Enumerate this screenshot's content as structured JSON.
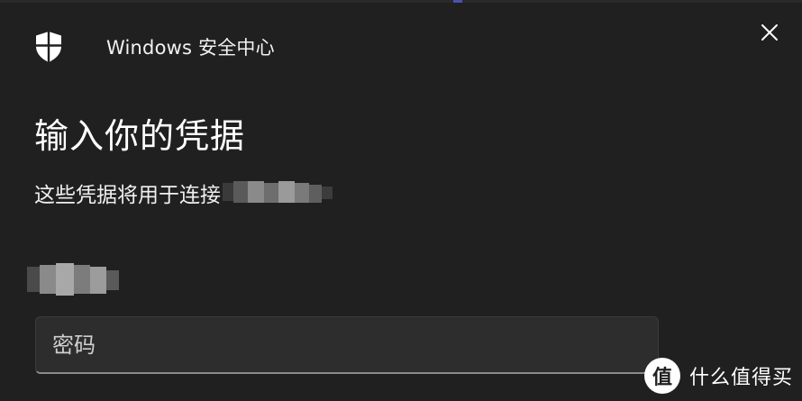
{
  "dialog": {
    "app_title": "Windows 安全中心",
    "heading": "输入你的凭据",
    "subtitle": "这些凭据将用于连接",
    "close_icon": "close-icon",
    "shield_icon": "shield-icon"
  },
  "password": {
    "placeholder": "密码",
    "value": ""
  },
  "watermark": {
    "logo_char": "值",
    "text": "什么值得买"
  },
  "colors": {
    "background": "#202020",
    "input_bg": "#2d2d2d",
    "text": "#ffffff"
  }
}
